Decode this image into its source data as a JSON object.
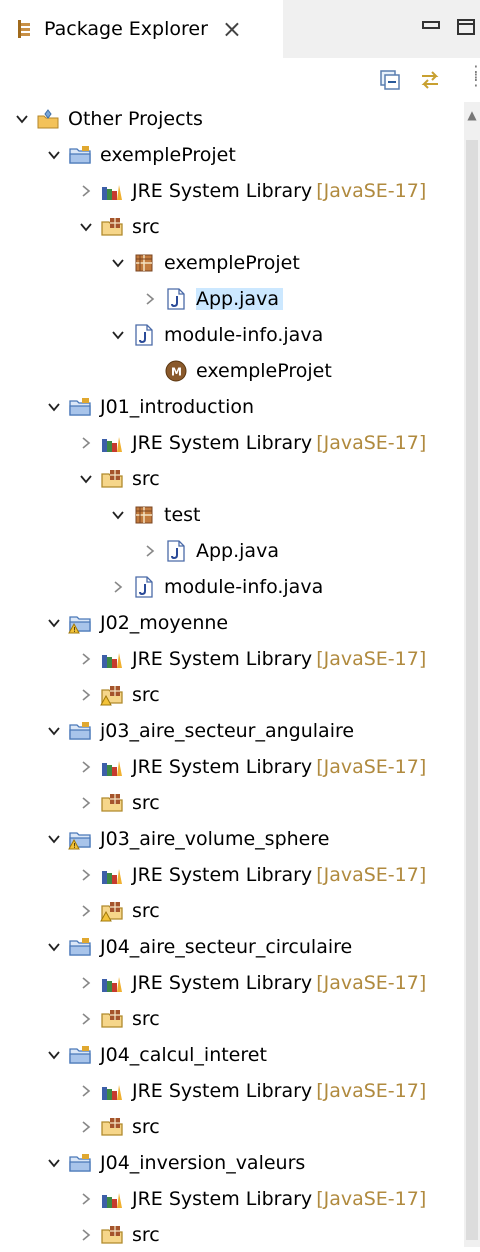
{
  "view": {
    "title": "Package Explorer"
  },
  "colors": {
    "selection": "#cce8ff",
    "decoration": "#b08a3e",
    "tab_bg": "#ffffff",
    "header_bg": "#f0f0f0"
  },
  "tree": [
    {
      "label": "Other Projects",
      "level": 0,
      "arrow": "expanded",
      "icon": "working-set-icon"
    },
    {
      "label": "exempleProjet",
      "level": 1,
      "arrow": "expanded",
      "icon": "project-folder-icon"
    },
    {
      "label": "JRE System Library",
      "decor": "[JavaSE-17]",
      "level": 2,
      "arrow": "collapsed",
      "icon": "library-icon"
    },
    {
      "label": "src",
      "level": 2,
      "arrow": "expanded",
      "icon": "source-folder-icon"
    },
    {
      "label": "exempleProjet",
      "level": 3,
      "arrow": "expanded",
      "icon": "package-icon"
    },
    {
      "label": "App.java",
      "level": 4,
      "arrow": "collapsed",
      "icon": "java-file-icon",
      "selected": true
    },
    {
      "label": "module-info.java",
      "level": 3,
      "arrow": "expanded",
      "icon": "java-file-icon"
    },
    {
      "label": "exempleProjet",
      "level": 4,
      "arrow": "none",
      "icon": "module-icon"
    },
    {
      "label": "J01_introduction",
      "level": 1,
      "arrow": "expanded",
      "icon": "project-folder-icon"
    },
    {
      "label": "JRE System Library",
      "decor": "[JavaSE-17]",
      "level": 2,
      "arrow": "collapsed",
      "icon": "library-icon"
    },
    {
      "label": "src",
      "level": 2,
      "arrow": "expanded",
      "icon": "source-folder-icon"
    },
    {
      "label": "test",
      "level": 3,
      "arrow": "expanded",
      "icon": "package-icon"
    },
    {
      "label": "App.java",
      "level": 4,
      "arrow": "collapsed",
      "icon": "java-file-icon"
    },
    {
      "label": "module-info.java",
      "level": 3,
      "arrow": "collapsed",
      "icon": "java-file-icon"
    },
    {
      "label": "J02_moyenne",
      "level": 1,
      "arrow": "expanded",
      "icon": "project-folder-warning-icon"
    },
    {
      "label": "JRE System Library",
      "decor": "[JavaSE-17]",
      "level": 2,
      "arrow": "collapsed",
      "icon": "library-icon"
    },
    {
      "label": "src",
      "level": 2,
      "arrow": "collapsed",
      "icon": "source-folder-warning-icon"
    },
    {
      "label": "j03_aire_secteur_angulaire",
      "level": 1,
      "arrow": "expanded",
      "icon": "project-folder-icon"
    },
    {
      "label": "JRE System Library",
      "decor": "[JavaSE-17]",
      "level": 2,
      "arrow": "collapsed",
      "icon": "library-icon"
    },
    {
      "label": "src",
      "level": 2,
      "arrow": "collapsed",
      "icon": "source-folder-icon"
    },
    {
      "label": "J03_aire_volume_sphere",
      "level": 1,
      "arrow": "expanded",
      "icon": "project-folder-warning-icon"
    },
    {
      "label": "JRE System Library",
      "decor": "[JavaSE-17]",
      "level": 2,
      "arrow": "collapsed",
      "icon": "library-icon"
    },
    {
      "label": "src",
      "level": 2,
      "arrow": "collapsed",
      "icon": "source-folder-warning-icon"
    },
    {
      "label": "J04_aire_secteur_circulaire",
      "level": 1,
      "arrow": "expanded",
      "icon": "project-folder-icon"
    },
    {
      "label": "JRE System Library",
      "decor": "[JavaSE-17]",
      "level": 2,
      "arrow": "collapsed",
      "icon": "library-icon"
    },
    {
      "label": "src",
      "level": 2,
      "arrow": "collapsed",
      "icon": "source-folder-icon"
    },
    {
      "label": "J04_calcul_interet",
      "level": 1,
      "arrow": "expanded",
      "icon": "project-folder-icon"
    },
    {
      "label": "JRE System Library",
      "decor": "[JavaSE-17]",
      "level": 2,
      "arrow": "collapsed",
      "icon": "library-icon"
    },
    {
      "label": "src",
      "level": 2,
      "arrow": "collapsed",
      "icon": "source-folder-icon"
    },
    {
      "label": "J04_inversion_valeurs",
      "level": 1,
      "arrow": "expanded",
      "icon": "project-folder-icon"
    },
    {
      "label": "JRE System Library",
      "decor": "[JavaSE-17]",
      "level": 2,
      "arrow": "collapsed",
      "icon": "library-icon"
    },
    {
      "label": "src",
      "level": 2,
      "arrow": "collapsed",
      "icon": "source-folder-icon"
    }
  ]
}
